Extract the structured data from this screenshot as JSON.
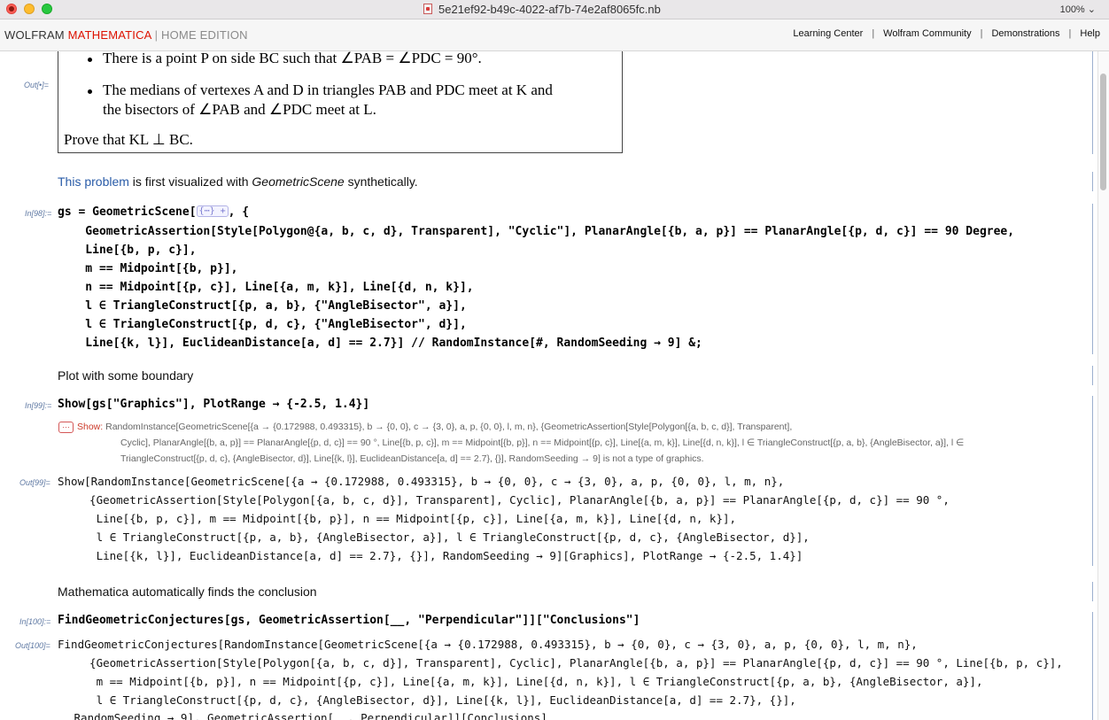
{
  "window": {
    "title": "5e21ef92-b49c-4022-af7b-74e2af8065fc.nb",
    "zoom": "100%"
  },
  "brand": {
    "wolfram": "WOLFRAM",
    "mathematica": "MATHEMATICA",
    "edition": "HOME EDITION"
  },
  "toplinks": [
    "Learning Center",
    "Wolfram Community",
    "Demonstrations",
    "Help"
  ],
  "cells": {
    "out_label_top": "Out[•]=",
    "problem_lines": [
      "There is a point P on side BC such that ∠PAB = ∠PDC = 90°.",
      "The medians of vertexes A and D in triangles PAB and PDC meet at K and",
      "the bisectors of ∠PAB and ∠PDC meet at L.",
      "Prove that KL ⊥ BC."
    ],
    "intro_link": "This problem",
    "intro_rest": " is first visualized with ",
    "intro_em": "GeometricScene",
    "intro_end": " synthetically.",
    "in98": "In[98]:=",
    "in98_lines": [
      "gs = GeometricScene[",
      ", {",
      "    GeometricAssertion[Style[Polygon@{a, b, c, d}, Transparent], \"Cyclic\"], PlanarAngle[{b, a, p}] == PlanarAngle[{p, d, c}] == 90 Degree,",
      "    Line[{b, p, c}],",
      "    m == Midpoint[{b, p}],",
      "    n == Midpoint[{p, c}], Line[{a, m, k}], Line[{d, n, k}],",
      "    l ∈ TriangleConstruct[{p, a, b}, {\"AngleBisector\", a}],",
      "    l ∈ TriangleConstruct[{p, d, c}, {\"AngleBisector\", d}],",
      "    Line[{k, l}], EuclideanDistance[a, d] == 2.7}] // RandomInstance[#, RandomSeeding → 9] &;"
    ],
    "expander": "{⋯} +",
    "plot_text": "Plot with some boundary",
    "in99": "In[99]:=",
    "in99_code": "Show[gs[\"Graphics\"], PlotRange → {-2.5, 1.4}]",
    "msg_dots": "⋯",
    "msg_tag": "Show",
    "msg_lines": [
      "RandomInstance[GeometricScene[{a → {0.172988, 0.493315}, b → {0, 0}, c → {3, 0}, a, p, {0, 0}, l, m, n}, {GeometricAssertion[Style[Polygon[{a, b, c, d}], Transparent],",
      "Cyclic], PlanarAngle[{b, a, p}] == PlanarAngle[{p, d, c}] == 90 °, Line[{b, p, c}], m == Midpoint[{b, p}], n == Midpoint[{p, c}], Line[{a, m, k}], Line[{d, n, k}], l ∈ TriangleConstruct[{p, a, b}, {AngleBisector, a}], l ∈",
      "TriangleConstruct[{p, d, c}, {AngleBisector, d}], Line[{k, l}], EuclideanDistance[a, d] == 2.7}, {}], RandomSeeding → 9] is not a type of graphics."
    ],
    "out99": "Out[99]=",
    "out99_lines": [
      "Show[RandomInstance[GeometricScene[{a → {0.172988, 0.493315}, b → {0, 0}, c → {3, 0}, a, p, {0, 0}, l, m, n},",
      "  {GeometricAssertion[Style[Polygon[{a, b, c, d}], Transparent], Cyclic], PlanarAngle[{b, a, p}] == PlanarAngle[{p, d, c}] == 90 °,",
      "   Line[{b, p, c}], m == Midpoint[{b, p}], n == Midpoint[{p, c}], Line[{a, m, k}], Line[{d, n, k}],",
      "   l ∈ TriangleConstruct[{p, a, b}, {AngleBisector, a}], l ∈ TriangleConstruct[{p, d, c}, {AngleBisector, d}],",
      "   Line[{k, l}], EuclideanDistance[a, d] == 2.7}, {}], RandomSeeding → 9][Graphics], PlotRange → {-2.5, 1.4}]"
    ],
    "conclusion_text": "Mathematica automatically finds the conclusion",
    "in100": "In[100]:=",
    "in100_code": "FindGeometricConjectures[gs, GeometricAssertion[__, \"Perpendicular\"]][\"Conclusions\"]",
    "out100": "Out[100]=",
    "out100_lines": [
      "FindGeometricConjectures[RandomInstance[GeometricScene[{a → {0.172988, 0.493315}, b → {0, 0}, c → {3, 0}, a, p, {0, 0}, l, m, n},",
      "  {GeometricAssertion[Style[Polygon[{a, b, c, d}], Transparent], Cyclic], PlanarAngle[{b, a, p}] == PlanarAngle[{p, d, c}] == 90 °, Line[{b, p, c}],",
      "   m == Midpoint[{b, p}], n == Midpoint[{p, c}], Line[{a, m, k}], Line[{d, n, k}], l ∈ TriangleConstruct[{p, a, b}, {AngleBisector, a}],",
      "   l ∈ TriangleConstruct[{p, d, c}, {AngleBisector, d}], Line[{k, l}], EuclideanDistance[a, d] == 2.7}, {}],",
      " RandomSeeding → 9], GeometricAssertion[__, Perpendicular]][Conclusions]"
    ]
  }
}
